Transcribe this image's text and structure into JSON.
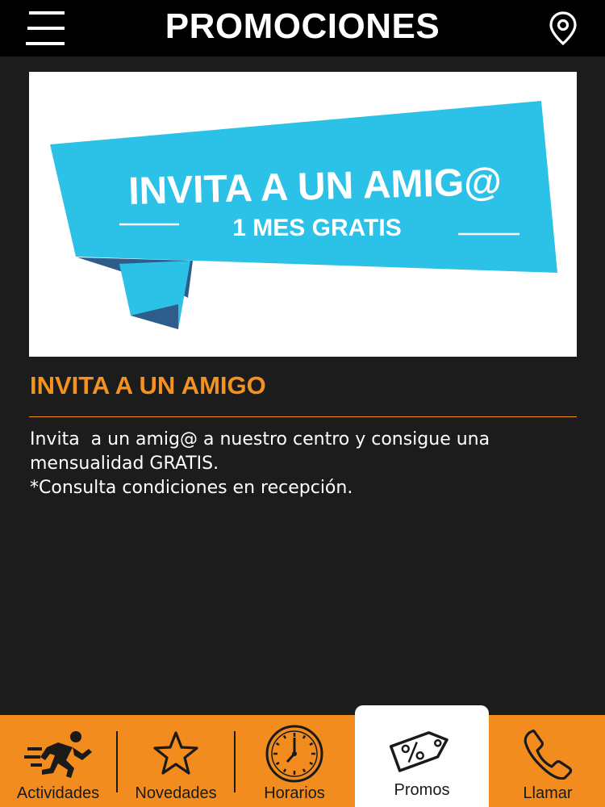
{
  "header": {
    "title": "PROMOCIONES",
    "menu_icon": "hamburger-menu-icon",
    "location_icon": "map-pin-icon"
  },
  "banner": {
    "headline": "INVITA A UN AMIG@",
    "subline": "1 MES GRATIS",
    "ribbon_color": "#2cc1e6",
    "fold_color": "#2e5d8b"
  },
  "promo": {
    "title": "INVITA A UN AMIGO",
    "description_lines": [
      "Invita  a un amig@ a nuestro centro y consigue una",
      "mensualidad GRATIS.",
      "*Consulta condiciones en recepción."
    ]
  },
  "tabs": [
    {
      "label": "Actividades",
      "icon": "runner-icon"
    },
    {
      "label": "Novedades",
      "icon": "star-icon"
    },
    {
      "label": "Horarios",
      "icon": "clock-icon"
    },
    {
      "label": "Promos",
      "icon": "discount-tag-icon",
      "active": true
    },
    {
      "label": "Llamar",
      "icon": "phone-icon"
    }
  ],
  "colors": {
    "accent": "#f39220",
    "tabbar": "#f28c1e",
    "background": "#1c1c1c",
    "topbar": "#000000"
  }
}
